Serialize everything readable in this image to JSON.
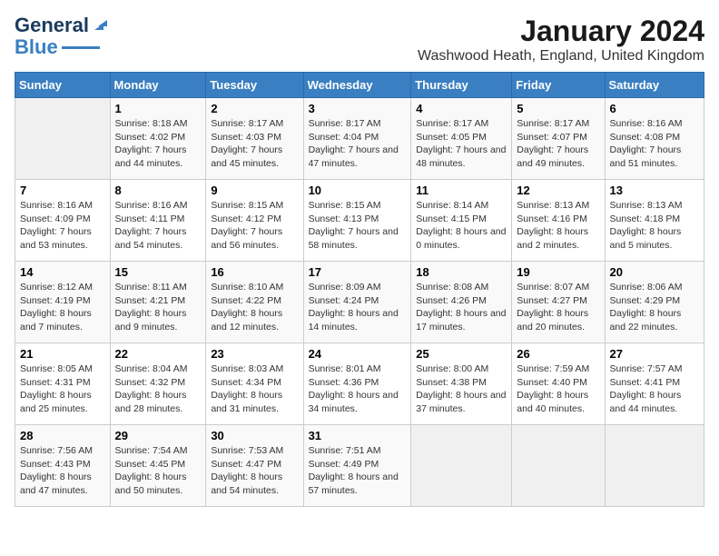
{
  "header": {
    "logo_general": "General",
    "logo_blue": "Blue",
    "main_title": "January 2024",
    "subtitle": "Washwood Heath, England, United Kingdom"
  },
  "calendar": {
    "days_of_week": [
      "Sunday",
      "Monday",
      "Tuesday",
      "Wednesday",
      "Thursday",
      "Friday",
      "Saturday"
    ],
    "weeks": [
      [
        {
          "day": "",
          "sunrise": "",
          "sunset": "",
          "daylight": "",
          "empty": true
        },
        {
          "day": "1",
          "sunrise": "Sunrise: 8:18 AM",
          "sunset": "Sunset: 4:02 PM",
          "daylight": "Daylight: 7 hours and 44 minutes."
        },
        {
          "day": "2",
          "sunrise": "Sunrise: 8:17 AM",
          "sunset": "Sunset: 4:03 PM",
          "daylight": "Daylight: 7 hours and 45 minutes."
        },
        {
          "day": "3",
          "sunrise": "Sunrise: 8:17 AM",
          "sunset": "Sunset: 4:04 PM",
          "daylight": "Daylight: 7 hours and 47 minutes."
        },
        {
          "day": "4",
          "sunrise": "Sunrise: 8:17 AM",
          "sunset": "Sunset: 4:05 PM",
          "daylight": "Daylight: 7 hours and 48 minutes."
        },
        {
          "day": "5",
          "sunrise": "Sunrise: 8:17 AM",
          "sunset": "Sunset: 4:07 PM",
          "daylight": "Daylight: 7 hours and 49 minutes."
        },
        {
          "day": "6",
          "sunrise": "Sunrise: 8:16 AM",
          "sunset": "Sunset: 4:08 PM",
          "daylight": "Daylight: 7 hours and 51 minutes."
        }
      ],
      [
        {
          "day": "7",
          "sunrise": "Sunrise: 8:16 AM",
          "sunset": "Sunset: 4:09 PM",
          "daylight": "Daylight: 7 hours and 53 minutes."
        },
        {
          "day": "8",
          "sunrise": "Sunrise: 8:16 AM",
          "sunset": "Sunset: 4:11 PM",
          "daylight": "Daylight: 7 hours and 54 minutes."
        },
        {
          "day": "9",
          "sunrise": "Sunrise: 8:15 AM",
          "sunset": "Sunset: 4:12 PM",
          "daylight": "Daylight: 7 hours and 56 minutes."
        },
        {
          "day": "10",
          "sunrise": "Sunrise: 8:15 AM",
          "sunset": "Sunset: 4:13 PM",
          "daylight": "Daylight: 7 hours and 58 minutes."
        },
        {
          "day": "11",
          "sunrise": "Sunrise: 8:14 AM",
          "sunset": "Sunset: 4:15 PM",
          "daylight": "Daylight: 8 hours and 0 minutes."
        },
        {
          "day": "12",
          "sunrise": "Sunrise: 8:13 AM",
          "sunset": "Sunset: 4:16 PM",
          "daylight": "Daylight: 8 hours and 2 minutes."
        },
        {
          "day": "13",
          "sunrise": "Sunrise: 8:13 AM",
          "sunset": "Sunset: 4:18 PM",
          "daylight": "Daylight: 8 hours and 5 minutes."
        }
      ],
      [
        {
          "day": "14",
          "sunrise": "Sunrise: 8:12 AM",
          "sunset": "Sunset: 4:19 PM",
          "daylight": "Daylight: 8 hours and 7 minutes."
        },
        {
          "day": "15",
          "sunrise": "Sunrise: 8:11 AM",
          "sunset": "Sunset: 4:21 PM",
          "daylight": "Daylight: 8 hours and 9 minutes."
        },
        {
          "day": "16",
          "sunrise": "Sunrise: 8:10 AM",
          "sunset": "Sunset: 4:22 PM",
          "daylight": "Daylight: 8 hours and 12 minutes."
        },
        {
          "day": "17",
          "sunrise": "Sunrise: 8:09 AM",
          "sunset": "Sunset: 4:24 PM",
          "daylight": "Daylight: 8 hours and 14 minutes."
        },
        {
          "day": "18",
          "sunrise": "Sunrise: 8:08 AM",
          "sunset": "Sunset: 4:26 PM",
          "daylight": "Daylight: 8 hours and 17 minutes."
        },
        {
          "day": "19",
          "sunrise": "Sunrise: 8:07 AM",
          "sunset": "Sunset: 4:27 PM",
          "daylight": "Daylight: 8 hours and 20 minutes."
        },
        {
          "day": "20",
          "sunrise": "Sunrise: 8:06 AM",
          "sunset": "Sunset: 4:29 PM",
          "daylight": "Daylight: 8 hours and 22 minutes."
        }
      ],
      [
        {
          "day": "21",
          "sunrise": "Sunrise: 8:05 AM",
          "sunset": "Sunset: 4:31 PM",
          "daylight": "Daylight: 8 hours and 25 minutes."
        },
        {
          "day": "22",
          "sunrise": "Sunrise: 8:04 AM",
          "sunset": "Sunset: 4:32 PM",
          "daylight": "Daylight: 8 hours and 28 minutes."
        },
        {
          "day": "23",
          "sunrise": "Sunrise: 8:03 AM",
          "sunset": "Sunset: 4:34 PM",
          "daylight": "Daylight: 8 hours and 31 minutes."
        },
        {
          "day": "24",
          "sunrise": "Sunrise: 8:01 AM",
          "sunset": "Sunset: 4:36 PM",
          "daylight": "Daylight: 8 hours and 34 minutes."
        },
        {
          "day": "25",
          "sunrise": "Sunrise: 8:00 AM",
          "sunset": "Sunset: 4:38 PM",
          "daylight": "Daylight: 8 hours and 37 minutes."
        },
        {
          "day": "26",
          "sunrise": "Sunrise: 7:59 AM",
          "sunset": "Sunset: 4:40 PM",
          "daylight": "Daylight: 8 hours and 40 minutes."
        },
        {
          "day": "27",
          "sunrise": "Sunrise: 7:57 AM",
          "sunset": "Sunset: 4:41 PM",
          "daylight": "Daylight: 8 hours and 44 minutes."
        }
      ],
      [
        {
          "day": "28",
          "sunrise": "Sunrise: 7:56 AM",
          "sunset": "Sunset: 4:43 PM",
          "daylight": "Daylight: 8 hours and 47 minutes."
        },
        {
          "day": "29",
          "sunrise": "Sunrise: 7:54 AM",
          "sunset": "Sunset: 4:45 PM",
          "daylight": "Daylight: 8 hours and 50 minutes."
        },
        {
          "day": "30",
          "sunrise": "Sunrise: 7:53 AM",
          "sunset": "Sunset: 4:47 PM",
          "daylight": "Daylight: 8 hours and 54 minutes."
        },
        {
          "day": "31",
          "sunrise": "Sunrise: 7:51 AM",
          "sunset": "Sunset: 4:49 PM",
          "daylight": "Daylight: 8 hours and 57 minutes."
        },
        {
          "day": "",
          "sunrise": "",
          "sunset": "",
          "daylight": "",
          "empty": true
        },
        {
          "day": "",
          "sunrise": "",
          "sunset": "",
          "daylight": "",
          "empty": true
        },
        {
          "day": "",
          "sunrise": "",
          "sunset": "",
          "daylight": "",
          "empty": true
        }
      ]
    ]
  }
}
